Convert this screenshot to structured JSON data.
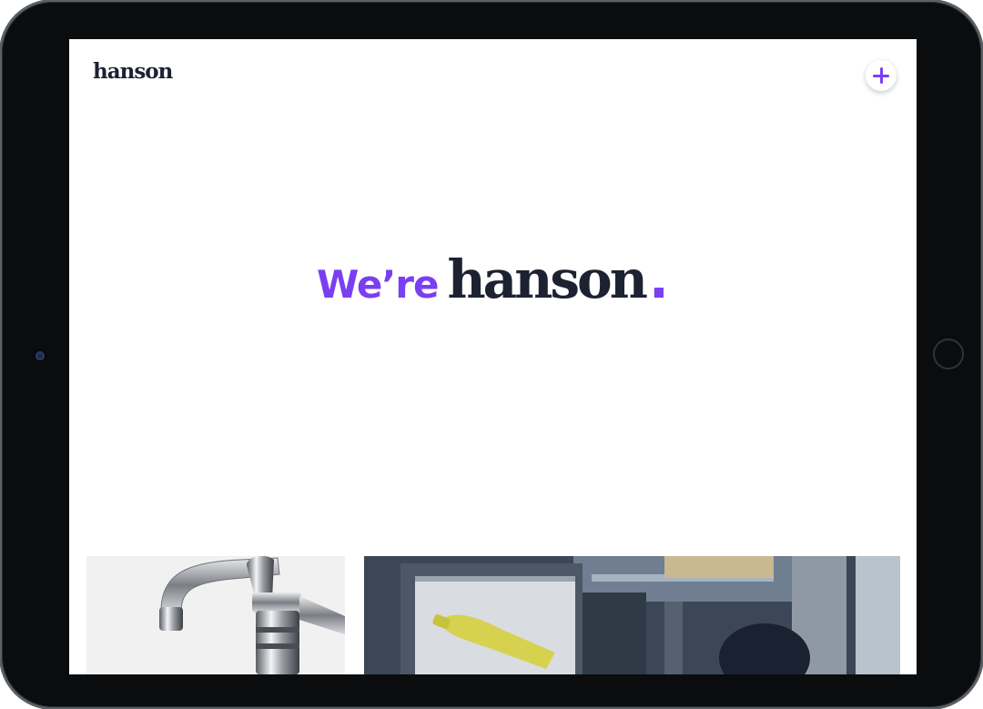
{
  "header": {
    "logo": "hanson",
    "menu_button_icon": "plus-icon"
  },
  "hero": {
    "lead": "We’re",
    "brand": "hanson",
    "dot": "."
  },
  "colors": {
    "accent": "#7a3ff2",
    "ink": "#1c2231",
    "background": "#ffffff"
  },
  "gallery": {
    "tiles": [
      {
        "subject": "chrome faucet"
      },
      {
        "subject": "factory with yellow bottle"
      }
    ]
  }
}
